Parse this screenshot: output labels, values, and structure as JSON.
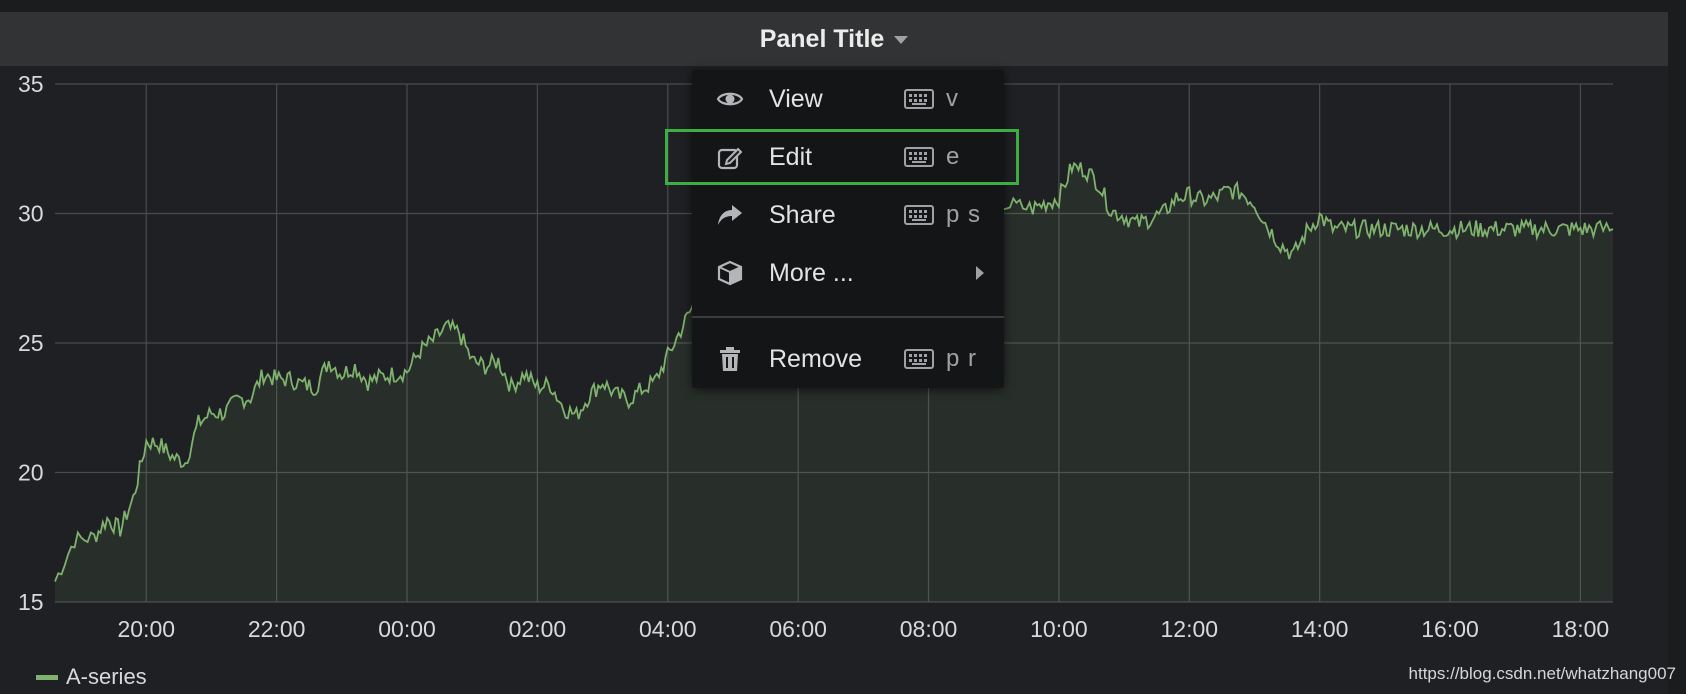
{
  "panel": {
    "title": "Panel Title"
  },
  "menu": {
    "items": [
      {
        "label": "View",
        "icon": "eye-icon",
        "shortcut": "v"
      },
      {
        "label": "Edit",
        "icon": "edit-icon",
        "shortcut": "e"
      },
      {
        "label": "Share",
        "icon": "share-icon",
        "shortcut": "p s"
      },
      {
        "label": "More ...",
        "icon": "cube-icon",
        "shortcut": ""
      },
      {
        "label": "Remove",
        "icon": "trash-icon",
        "shortcut": "p r"
      }
    ],
    "highlighted_item": "Edit"
  },
  "legend": {
    "series_name": "A-series"
  },
  "watermark": "https://blog.csdn.net/whatzhang007",
  "colors": {
    "series": "#7eb26d",
    "highlight": "#3cae42",
    "background": "#1f2023",
    "header": "#323335"
  },
  "chart_data": {
    "type": "area",
    "title": "",
    "xlabel": "",
    "ylabel": "",
    "ylim": [
      15,
      35
    ],
    "y_ticks": [
      "15",
      "20",
      "25",
      "30",
      "35"
    ],
    "x_ticks": [
      "20:00",
      "22:00",
      "00:00",
      "02:00",
      "04:00",
      "06:00",
      "08:00",
      "10:00",
      "12:00",
      "14:00",
      "16:00",
      "18:00"
    ],
    "x_range_hours": [
      18.6,
      42.5
    ],
    "grid": true,
    "legend_position": "bottom-left",
    "series": [
      {
        "name": "A-series",
        "x": [
          18.6,
          18.9,
          19.2,
          19.4,
          19.6,
          19.8,
          20.0,
          20.2,
          20.4,
          20.6,
          20.8,
          21.0,
          21.2,
          21.4,
          21.6,
          21.8,
          22.0,
          22.2,
          22.4,
          22.6,
          22.8,
          23.0,
          23.2,
          23.4,
          23.6,
          23.8,
          24.0,
          24.2,
          24.4,
          24.6,
          24.8,
          25.0,
          25.2,
          25.4,
          25.6,
          25.8,
          26.0,
          26.2,
          26.4,
          26.6,
          26.8,
          27.0,
          27.2,
          27.4,
          27.6,
          27.8,
          28.0,
          28.2,
          28.4,
          28.6,
          28.8,
          29.0,
          29.2,
          29.4,
          29.6,
          29.8,
          30.0,
          30.2,
          30.5,
          30.8,
          31.0,
          31.2,
          31.4,
          31.6,
          31.8,
          32.0,
          32.2,
          32.4,
          32.6,
          32.8,
          33.0,
          33.3,
          33.6,
          33.8,
          34.0,
          34.2,
          34.4,
          34.6,
          34.8,
          35.0,
          35.2,
          35.4,
          35.6,
          35.8,
          36.0,
          36.2,
          36.4,
          36.6,
          36.8,
          37.0,
          37.2,
          37.4,
          37.6,
          37.8,
          38.0,
          38.2,
          38.4,
          38.6,
          38.8,
          39.0,
          39.2,
          39.4,
          39.6,
          39.8,
          40.0,
          40.2,
          40.4,
          40.6,
          40.8,
          41.0,
          41.2,
          41.4,
          41.6,
          41.8,
          42.0,
          42.2,
          42.5
        ],
        "values": [
          15.8,
          17.4,
          17.5,
          18.2,
          17.8,
          19.0,
          21.2,
          21.1,
          20.6,
          20.4,
          21.9,
          22.3,
          22.3,
          22.8,
          22.9,
          23.8,
          23.6,
          23.6,
          23.4,
          23.3,
          24.3,
          23.8,
          24.1,
          23.5,
          23.7,
          23.8,
          23.9,
          24.7,
          25.1,
          25.6,
          25.4,
          24.3,
          24.1,
          24.3,
          23.3,
          23.8,
          23.3,
          23.4,
          22.5,
          22.2,
          23.0,
          23.5,
          23.0,
          22.8,
          23.2,
          23.5,
          24.5,
          25.5,
          26.5,
          27.5,
          28.5,
          29.2,
          29.5,
          29.8,
          30.5,
          31.5,
          33.2,
          33.8,
          34.1,
          33.9,
          33.6,
          33.8,
          33.3,
          31.9,
          31.4,
          31.5,
          32.2,
          32.0,
          31.4,
          30.7,
          30.4,
          30.3,
          30.2,
          30.4,
          30.6,
          31.8,
          31.7,
          31.2,
          30.1,
          29.9,
          29.6,
          29.8,
          30.0,
          30.6,
          30.7,
          30.5,
          30.6,
          30.9,
          30.8,
          30.4,
          29.5,
          28.8,
          28.4,
          29.3,
          29.9,
          29.4,
          29.4,
          29.4,
          29.4,
          29.4,
          29.4,
          29.4,
          29.4,
          29.4,
          29.4,
          29.4,
          29.4,
          29.4,
          29.4,
          29.4,
          29.4,
          29.4,
          29.4,
          29.4,
          29.4,
          29.4,
          29.4
        ]
      }
    ]
  }
}
